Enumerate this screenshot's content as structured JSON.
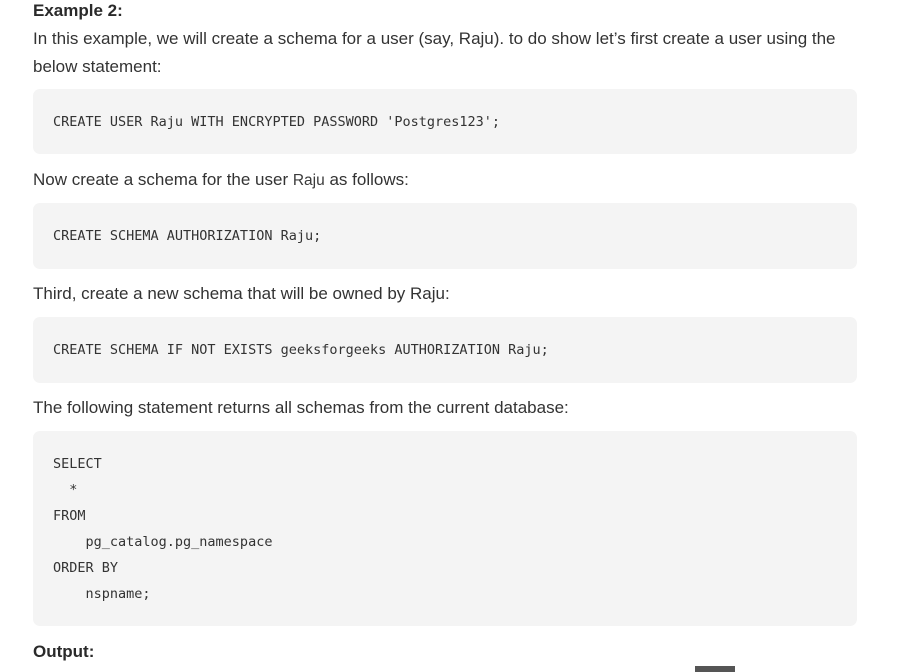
{
  "example": {
    "heading": "Example 2:",
    "intro": "In this example, we will create a schema for a user (say, Raju). to do show let’s first create a user using the below statement:",
    "code1": [
      "CREATE USER Raju WITH ENCRYPTED PASSWORD 'Postgres123';"
    ],
    "step2_before": "Now create a schema for the user ",
    "step2_code": "Raju",
    "step2_after": " as follows:",
    "code2": [
      "CREATE SCHEMA AUTHORIZATION Raju;"
    ],
    "step3": "Third, create a new schema that will be owned by Raju:",
    "code3": [
      "CREATE SCHEMA IF NOT EXISTS geeksforgeeks AUTHORIZATION Raju;"
    ],
    "step4": "The following statement returns all schemas from the current database:",
    "code4": [
      "SELECT",
      "  *",
      "FROM",
      "    pg_catalog.pg_namespace",
      "ORDER BY",
      "    nspname;"
    ],
    "output_heading": "Output:"
  }
}
